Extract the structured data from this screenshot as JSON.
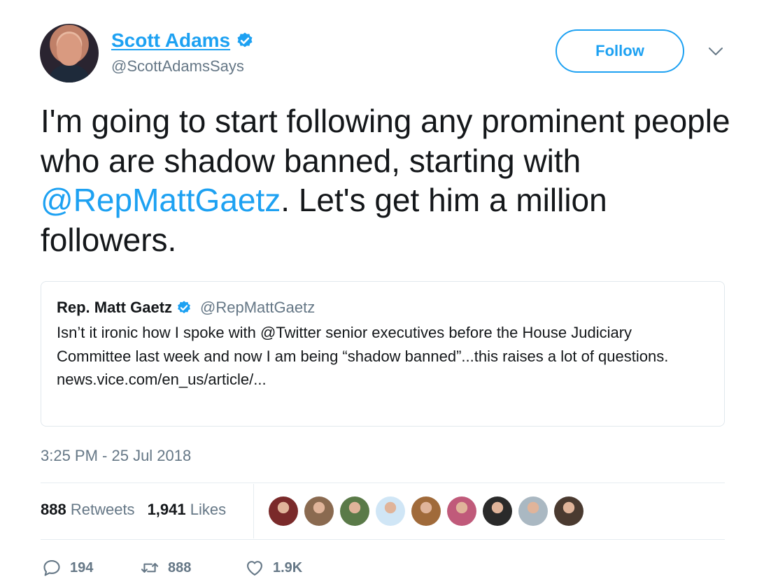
{
  "author": {
    "name": "Scott Adams",
    "handle": "@ScottAdamsSays",
    "verified": true
  },
  "header": {
    "follow_label": "Follow"
  },
  "tweet": {
    "text_before": "I'm going to start following any prominent people who are shadow banned, starting with ",
    "mention": "@RepMattGaetz",
    "text_after": ". Let's get him a million followers."
  },
  "quoted": {
    "name": "Rep. Matt Gaetz",
    "handle": "@RepMattGaetz",
    "verified": true,
    "text": "Isn’t it ironic how I spoke with @Twitter senior executives before the House Judiciary Committee last week and now I am being “shadow banned”...this raises a lot of questions.",
    "link": "news.vice.com/en_us/article/..."
  },
  "timestamp": "3:25 PM - 25 Jul 2018",
  "stats": {
    "retweets_count": "888",
    "retweets_label": "Retweets",
    "likes_count": "1,941",
    "likes_label": "Likes"
  },
  "likers": [
    {
      "name": "liker-1",
      "color": "#7a2a2a"
    },
    {
      "name": "liker-2",
      "color": "#8a6a50"
    },
    {
      "name": "liker-3",
      "color": "#5a7a48"
    },
    {
      "name": "liker-4",
      "color": "#d0e6f6"
    },
    {
      "name": "liker-5",
      "color": "#a06a3a"
    },
    {
      "name": "liker-6",
      "color": "#c05a7a"
    },
    {
      "name": "liker-7",
      "color": "#2a2a2a"
    },
    {
      "name": "liker-8",
      "color": "#aab8c2"
    },
    {
      "name": "liker-9",
      "color": "#4a3a30"
    }
  ],
  "actions": {
    "replies": "194",
    "retweets": "888",
    "likes": "1.9K"
  },
  "colors": {
    "accent": "#1da1f2",
    "text": "#14171a",
    "secondary": "#657786",
    "border": "#e1e8ed"
  },
  "icons": {
    "verified": "verified-badge-icon",
    "caret": "chevron-down-icon",
    "reply": "reply-icon",
    "retweet": "retweet-icon",
    "like": "heart-icon"
  }
}
